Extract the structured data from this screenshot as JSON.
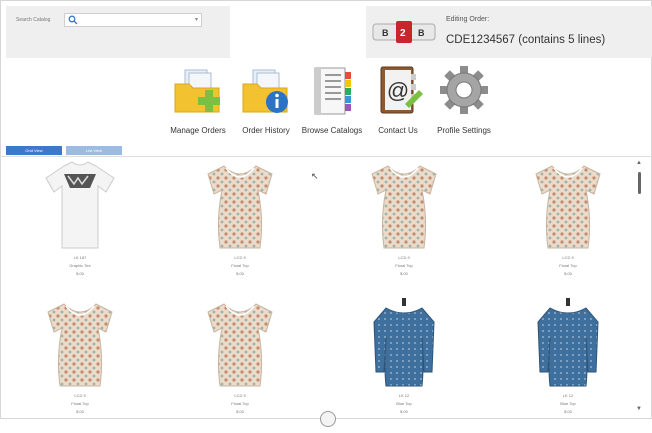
{
  "search": {
    "label": "Search Catalog",
    "value": "",
    "placeholder": ""
  },
  "order": {
    "logo_text": "B2B",
    "editing_label": "Editing Order:",
    "order_id": "CDE1234567 (contains 5 lines)"
  },
  "nav": {
    "items": [
      {
        "label": "Manage Orders",
        "icon": "folder-plus-icon"
      },
      {
        "label": "Order History",
        "icon": "folder-info-icon"
      },
      {
        "label": "Browse Catalogs",
        "icon": "catalog-book-icon"
      },
      {
        "label": "Contact Us",
        "icon": "address-book-icon"
      },
      {
        "label": "Profile Settings",
        "icon": "gear-icon"
      }
    ]
  },
  "view_tabs": [
    "Grid View",
    "List View"
  ],
  "products": [
    {
      "sku": "LK 187",
      "desc": "Graphic Tee",
      "price": "$.00",
      "type": "tee"
    },
    {
      "sku": "LCD 9",
      "desc": "Floral Top",
      "price": "$.00",
      "type": "floral"
    },
    {
      "sku": "LCD 9",
      "desc": "Floral Top",
      "price": "$.00",
      "type": "floral"
    },
    {
      "sku": "LCD 9",
      "desc": "Floral Top",
      "price": "$.00",
      "type": "floral"
    },
    {
      "sku": "LCD 9",
      "desc": "Floral Top",
      "price": "$.00",
      "type": "floral"
    },
    {
      "sku": "LCD 9",
      "desc": "Floral Top",
      "price": "$.00",
      "type": "floral"
    },
    {
      "sku": "LK 12",
      "desc": "Blue Top",
      "price": "$.00",
      "type": "blue"
    },
    {
      "sku": "LK 12",
      "desc": "Blue Top",
      "price": "$.00",
      "type": "blue"
    }
  ],
  "colors": {
    "accent": "#3d79c6",
    "accent_light": "#9cbbe3",
    "panel_bg": "#efefef",
    "folder": "#f2c230",
    "plus": "#7bc043",
    "info": "#2b73c4"
  }
}
